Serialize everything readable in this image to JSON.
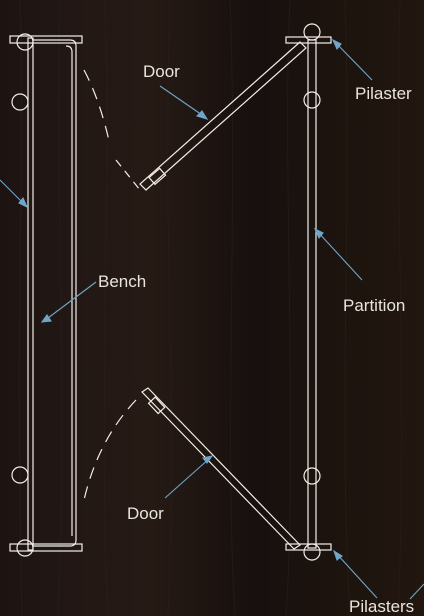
{
  "labels": {
    "door_top": "Door",
    "pilaster_top": "Pilaster",
    "bench": "Bench",
    "partition": "Partition",
    "door_bottom": "Door",
    "pilasters_bottom": "Pilasters"
  },
  "colors": {
    "background": "#1a1210",
    "wood_grain": "#2a1d17",
    "linework": "#f2efe9",
    "leader_line": "#6fa6c8",
    "label_text": "#e8e4de"
  }
}
